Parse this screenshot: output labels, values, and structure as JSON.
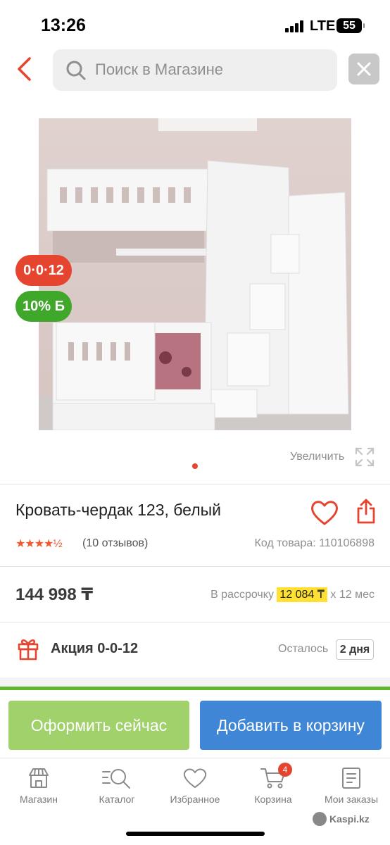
{
  "status_bar": {
    "time": "13:26",
    "network": "LTE",
    "battery": "55"
  },
  "header": {
    "search_placeholder": "Поиск в Магазине"
  },
  "gallery": {
    "badge_installment": "0·0·12",
    "badge_bonus": "10% Б",
    "zoom_label": "Увеличить"
  },
  "product": {
    "title": "Кровать-чердак 123, белый",
    "rating_stars": "★★★★½",
    "reviews": "(10 отзывов)",
    "sku": "Код товара: 110106898",
    "price": "144 998 ₸",
    "installment_prefix": "В рассрочку",
    "installment_amount": "12 084 ₸",
    "installment_suffix": "x 12 мес"
  },
  "promo": {
    "label": "Акция 0-0-12",
    "remain_label": "Осталось",
    "remain_days": "2 дня"
  },
  "actions": {
    "buy_now": "Оформить сейчас",
    "add_to_cart": "Добавить в корзину"
  },
  "nav": {
    "items": [
      {
        "label": "Магазин",
        "icon": "shop-icon"
      },
      {
        "label": "Каталог",
        "icon": "catalog-search-icon"
      },
      {
        "label": "Избранное",
        "icon": "heart-icon"
      },
      {
        "label": "Корзина",
        "icon": "cart-icon"
      },
      {
        "label": "Мои заказы",
        "icon": "orders-icon"
      }
    ],
    "cart_count": "4"
  },
  "watermark": "Kaspi.kz",
  "colors": {
    "accent_red": "#e5442f",
    "bonus_green": "#3fa82b",
    "buy_green": "#a0d16b",
    "cart_blue": "#3f87d6",
    "highlight_yellow": "#ffe033"
  }
}
